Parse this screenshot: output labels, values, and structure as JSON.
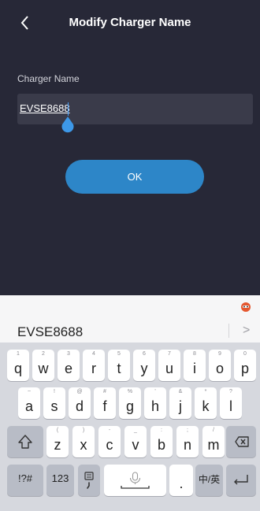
{
  "header": {
    "title": "Modify Charger Name"
  },
  "form": {
    "label": "Charger Name",
    "value": "EVSE8688"
  },
  "ok_button": {
    "label": "OK"
  },
  "suggestion": {
    "text": "EVSE8688",
    "more": ">"
  },
  "keyboard": {
    "row1": [
      {
        "k": "q",
        "h": "1"
      },
      {
        "k": "w",
        "h": "2"
      },
      {
        "k": "e",
        "h": "3"
      },
      {
        "k": "r",
        "h": "4"
      },
      {
        "k": "t",
        "h": "5"
      },
      {
        "k": "y",
        "h": "6"
      },
      {
        "k": "u",
        "h": "7"
      },
      {
        "k": "i",
        "h": "8"
      },
      {
        "k": "o",
        "h": "9"
      },
      {
        "k": "p",
        "h": "0"
      }
    ],
    "row2": [
      {
        "k": "a",
        "h": "~"
      },
      {
        "k": "s",
        "h": "!"
      },
      {
        "k": "d",
        "h": "@"
      },
      {
        "k": "f",
        "h": "#"
      },
      {
        "k": "g",
        "h": "%"
      },
      {
        "k": "h",
        "h": "'"
      },
      {
        "k": "j",
        "h": "&"
      },
      {
        "k": "k",
        "h": "*"
      },
      {
        "k": "l",
        "h": "?"
      }
    ],
    "row3": [
      {
        "k": "z",
        "h": "("
      },
      {
        "k": "x",
        "h": ")"
      },
      {
        "k": "c",
        "h": "-"
      },
      {
        "k": "v",
        "h": "_"
      },
      {
        "k": "b",
        "h": ":"
      },
      {
        "k": "n",
        "h": ";"
      },
      {
        "k": "m",
        "h": "/"
      }
    ],
    "symbols": "!?#",
    "numbers": "123",
    "period": ".",
    "lang": "中/英"
  }
}
